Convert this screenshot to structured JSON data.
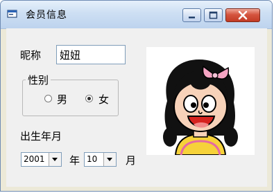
{
  "window": {
    "title": "会员信息",
    "title_icon": "app-window-icon",
    "minimize_icon": "minimize-icon",
    "maximize_icon": "maximize-icon",
    "close_icon": "close-icon"
  },
  "form": {
    "nickname_label": "昵称",
    "nickname_value": "妞妞",
    "gender_group_label": "性别",
    "gender_options": [
      {
        "label": "男",
        "checked": false
      },
      {
        "label": "女",
        "checked": true
      }
    ],
    "birth_label": "出生年月",
    "year_value": "2001",
    "year_unit": "年",
    "month_value": "10",
    "month_unit": "月"
  },
  "avatar": {
    "description_icon": "cartoon-girl-avatar",
    "colors": {
      "hair": "#111111",
      "bow": "#f5a4c3",
      "face": "#f7d2b9",
      "mouth": "#d6231f",
      "shirt": "#f6d23a"
    }
  }
}
